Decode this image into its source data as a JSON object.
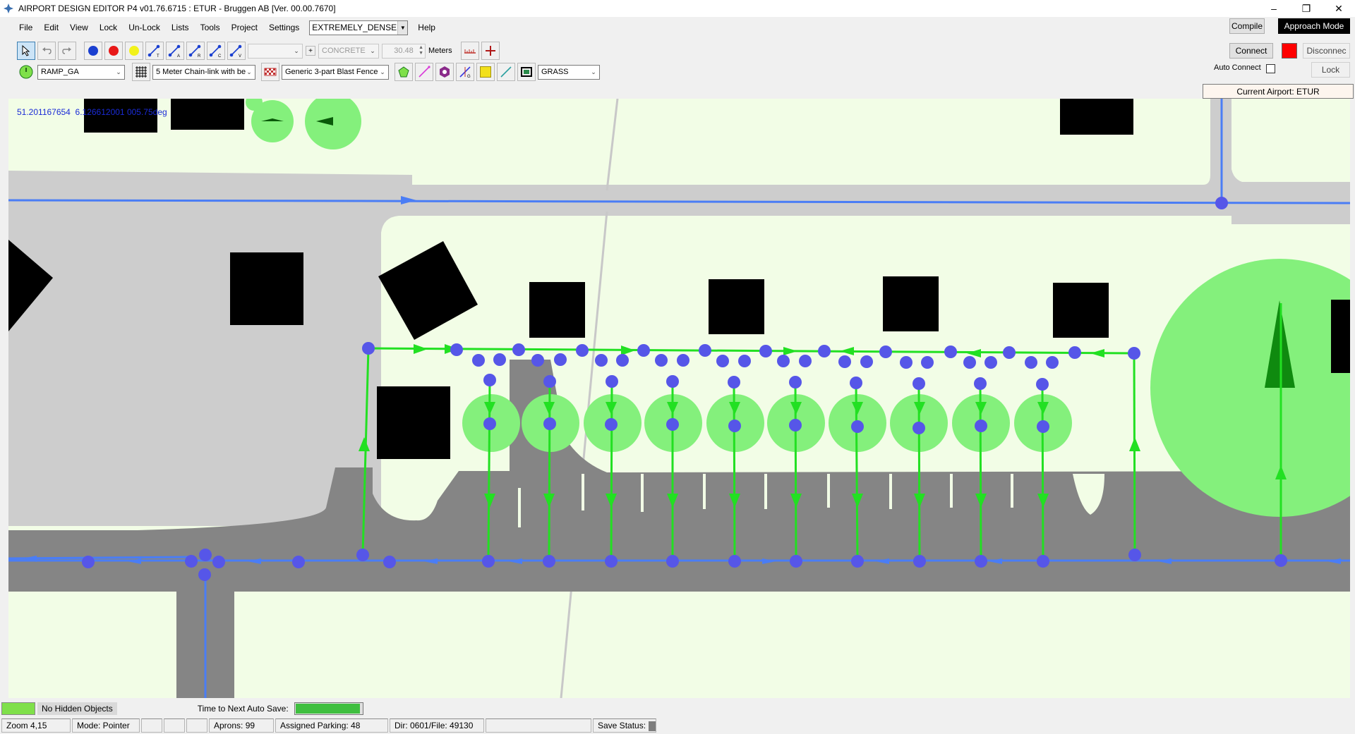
{
  "window": {
    "title": "AIRPORT DESIGN EDITOR P4  v01.76.6715 : ETUR - Bruggen AB [Ver. 00.00.7670]",
    "controls": [
      "minimize-icon",
      "restore-icon",
      "close-icon"
    ]
  },
  "menu": {
    "items": [
      "File",
      "Edit",
      "View",
      "Lock",
      "Un-Lock",
      "Lists",
      "Tools",
      "Project",
      "Settings"
    ],
    "density_value": "EXTREMELY_DENSE",
    "help": "Help"
  },
  "toolbar1": {
    "tools": [
      "pointer-icon",
      "undo-icon",
      "redo-icon",
      "blue-node-icon",
      "red-node-icon",
      "yellow-node-icon",
      "link-t-icon",
      "link-a-icon",
      "link-r-icon",
      "link-c-icon",
      "link-v-icon"
    ],
    "empty_combo_value": "",
    "plus": "+",
    "surface_value": "CONCRETE",
    "width_value": "30.48",
    "units": "Meters",
    "ruler_icon": "ruler-icon",
    "add_icon": "crosshair-plus-icon"
  },
  "toolbar2": {
    "ramp_value": "RAMP_GA",
    "fence_value": "5 Meter Chain-link with be",
    "blast_value": "Generic 3-part Blast Fence",
    "ground_value": "GRASS",
    "tools": [
      "clock-icon",
      "grid-icon",
      "blast-fence-icon",
      "polygon-icon",
      "line-draw-icon",
      "object-icon",
      "measure-icon",
      "yellow-fill-icon",
      "diagonal-line-icon",
      "frame-icon"
    ]
  },
  "right_panel": {
    "compile": "Compile",
    "approach_mode": "Approach Mode",
    "connect": "Connect",
    "disconnect": "Disconnec",
    "auto_connect": "Auto Connect",
    "lock": "Lock",
    "current_airport": "Current Airport: ETUR",
    "connection_color": "#ff0000"
  },
  "map": {
    "coords_lat": "51.201167654",
    "coords_rest": "6.126612001 005.75deg",
    "colors": {
      "grass": "#f2fde6",
      "apron": "#cdcdcd",
      "taxiway": "#858585",
      "building": "#000000",
      "node": "#5656e8",
      "blue_link": "#4a7df5",
      "green_link": "#22e022",
      "tree": "#84f07c"
    }
  },
  "status": {
    "hidden_objects": "No Hidden Objects",
    "autosave_label": "Time to Next Auto Save:",
    "autosave_progress": 0.97,
    "zoom": "Zoom 4,15",
    "mode": "Mode: Pointer",
    "aprons": "Aprons: 99",
    "assigned_parking": "Assigned Parking: 48",
    "dir_file": "Dir: 0601/File: 49130",
    "save_status": "Save Status:"
  }
}
